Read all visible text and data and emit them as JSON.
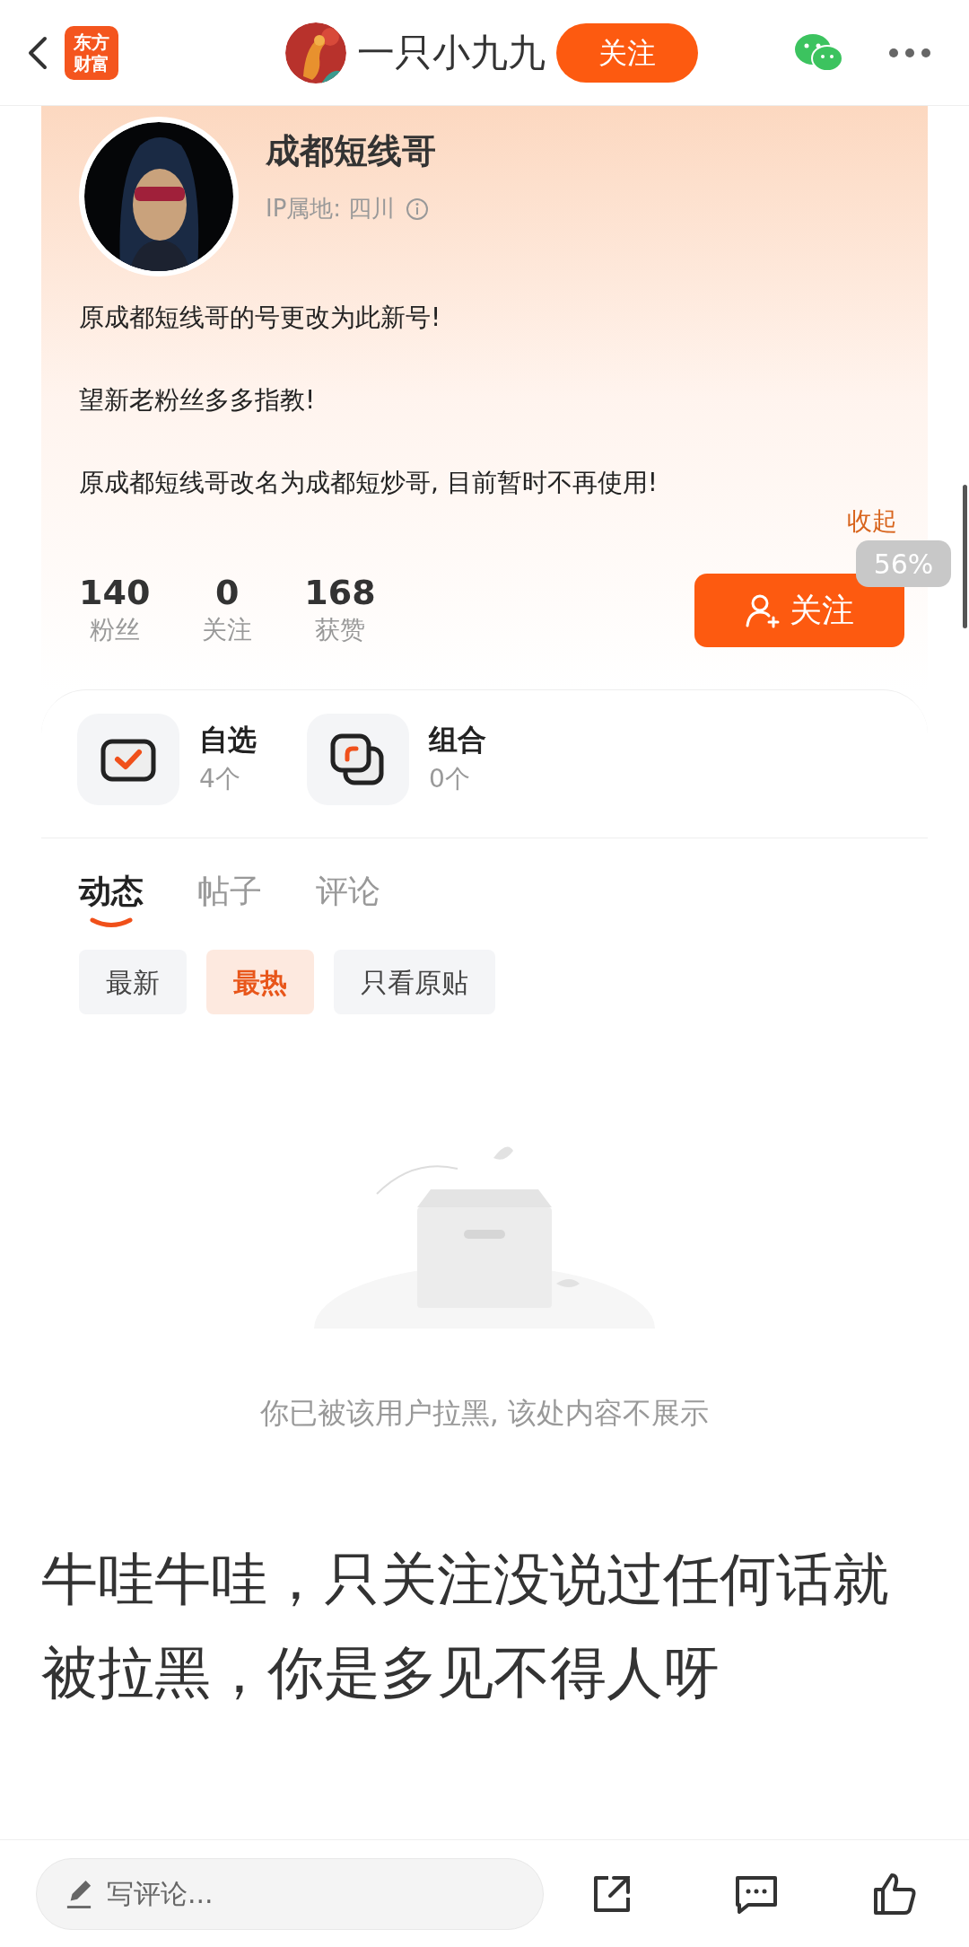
{
  "top_bar": {
    "logo_lines": [
      "东方",
      "财富"
    ],
    "user_name": "一只小九九",
    "follow_button": "关注"
  },
  "profile": {
    "name": "成都短线哥",
    "ip_location": "IP属地: 四川",
    "bio": [
      "原成都短线哥的号更改为此新号!",
      "望新老粉丝多多指教!",
      "原成都短线哥改名为成都短炒哥, 目前暂时不再使用!"
    ],
    "collapse_link": "收起",
    "zoom_badge": "56%",
    "stats": [
      {
        "value": "140",
        "label": "粉丝"
      },
      {
        "value": "0",
        "label": "关注"
      },
      {
        "value": "168",
        "label": "获赞"
      }
    ],
    "follow_button": "关注"
  },
  "collections": [
    {
      "kind": "watchlist",
      "title": "自选",
      "count": "4个"
    },
    {
      "kind": "portfolio",
      "title": "组合",
      "count": "0个"
    }
  ],
  "tabs": [
    {
      "label": "动态",
      "selected": true
    },
    {
      "label": "帖子",
      "selected": false
    },
    {
      "label": "评论",
      "selected": false
    }
  ],
  "filters": [
    {
      "label": "最新",
      "selected": false
    },
    {
      "label": "最热",
      "selected": true
    },
    {
      "label": "只看原贴",
      "selected": false
    }
  ],
  "empty_state": {
    "message": "你已被该用户拉黑, 该处内容不展示"
  },
  "post_text": "牛哇牛哇，只关注没说过任何话就被拉黑，你是多见不得人呀",
  "bottom_bar": {
    "comment_placeholder": "写评论..."
  }
}
